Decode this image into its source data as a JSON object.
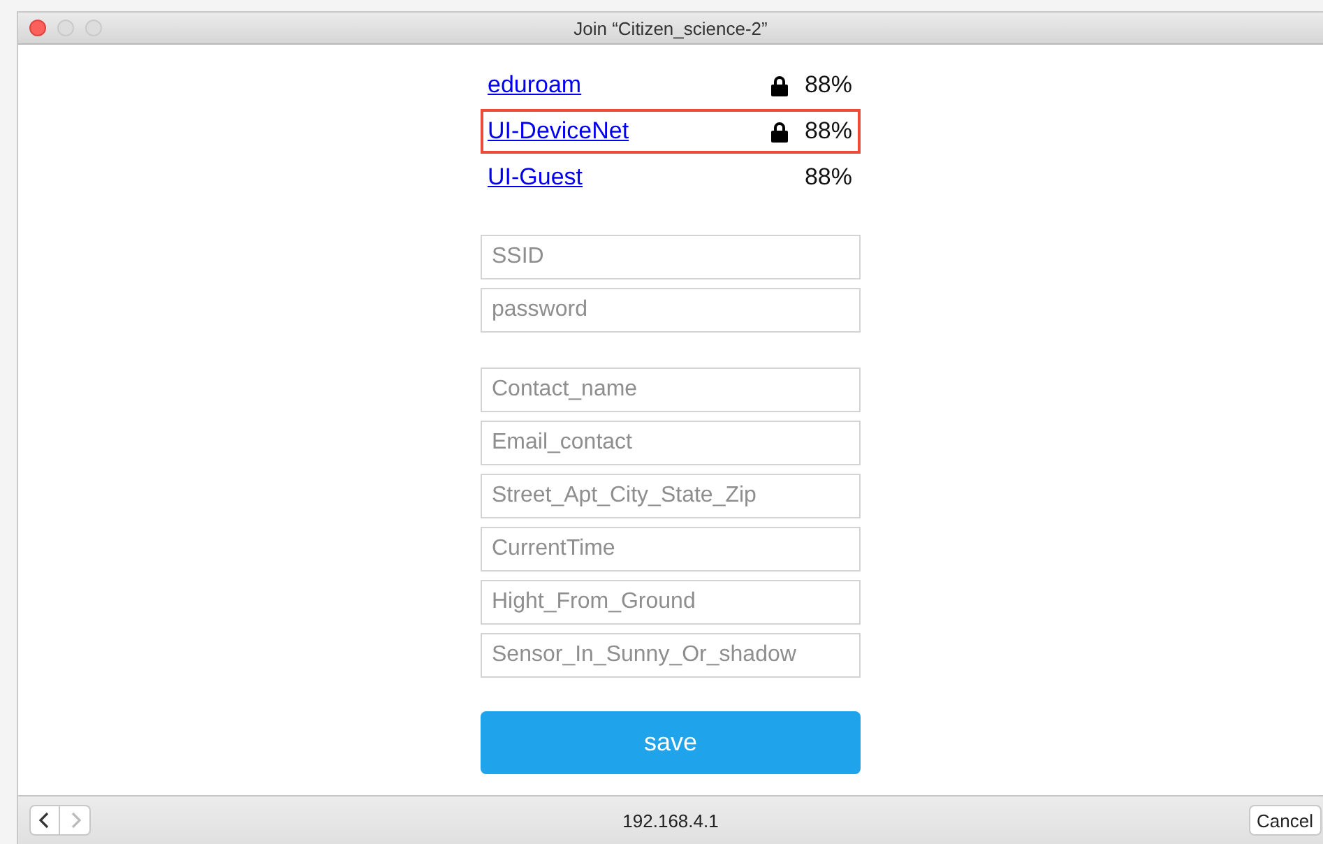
{
  "window": {
    "title": "Join “Citizen_science-2”"
  },
  "networks": [
    {
      "name": "eduroam",
      "locked": true,
      "signal": "88%",
      "selected": false
    },
    {
      "name": "UI-DeviceNet",
      "locked": true,
      "signal": "88%",
      "selected": true
    },
    {
      "name": "UI-Guest",
      "locked": false,
      "signal": "88%",
      "selected": false
    }
  ],
  "field_groups": [
    [
      {
        "placeholder": "SSID"
      },
      {
        "placeholder": "password"
      }
    ],
    [
      {
        "placeholder": "Contact_name"
      },
      {
        "placeholder": "Email_contact"
      },
      {
        "placeholder": "Street_Apt_City_State_Zip"
      },
      {
        "placeholder": "CurrentTime"
      },
      {
        "placeholder": "Hight_From_Ground"
      },
      {
        "placeholder": "Sensor_In_Sunny_Or_shadow"
      }
    ]
  ],
  "save_button": "save",
  "toolbar": {
    "back_disabled": false,
    "forward_disabled": true,
    "address": "192.168.4.1",
    "cancel_button": "Cancel"
  }
}
